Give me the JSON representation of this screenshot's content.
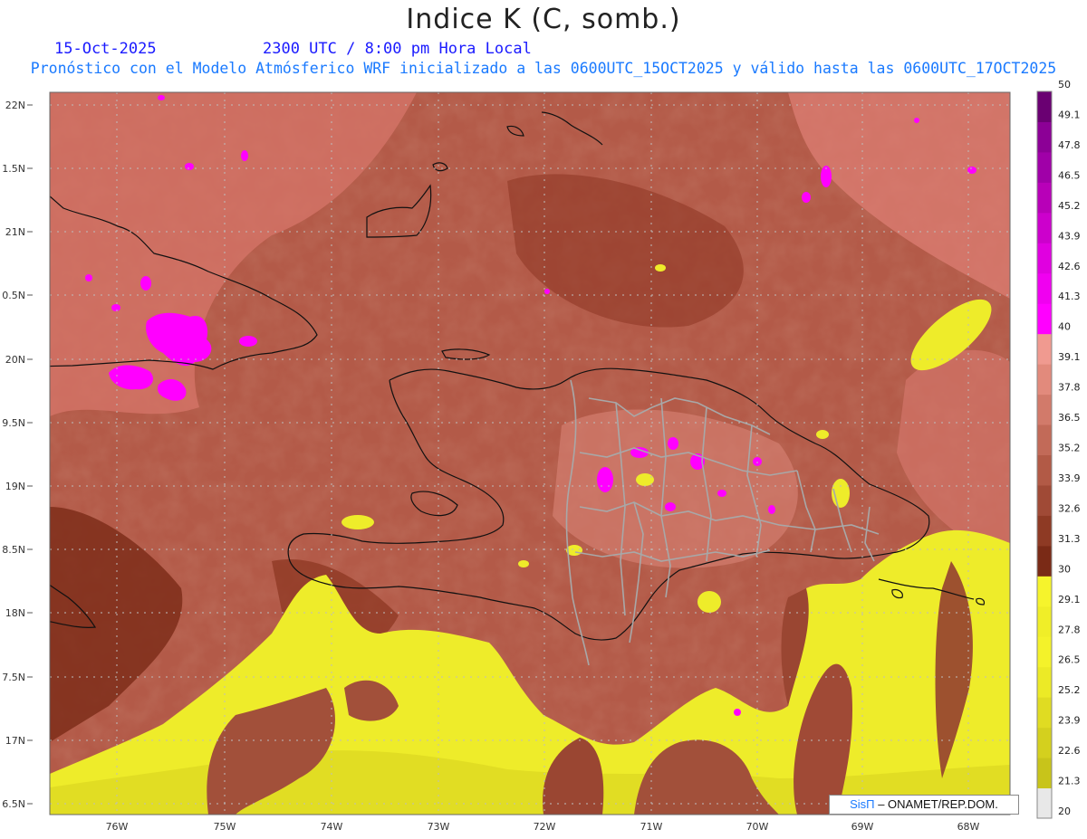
{
  "header": {
    "title": "Indice K (C, somb.)",
    "date": "15-Oct-2025",
    "time": "2300 UTC / 8:00 pm Hora Local",
    "forecast_info": "Pronóstico con el Modelo Atmósferico WRF inicializado a las 0600UTC_15OCT2025 y válido hasta las  0600UTC_17OCT2025"
  },
  "map": {
    "lat_labels": [
      "22N",
      "1.5N",
      "21N",
      "0.5N",
      "20N",
      "9.5N",
      "19N",
      "8.5N",
      "18N",
      "7.5N",
      "17N",
      "6.5N"
    ],
    "lon_labels": [
      "76W",
      "75W",
      "74W",
      "73W",
      "72W",
      "71W",
      "70W",
      "69W",
      "68W"
    ]
  },
  "colorbar": {
    "levels": [
      "20",
      "21.3",
      "22.6",
      "23.9",
      "25.2",
      "26.5",
      "27.8",
      "29.1",
      "30",
      "31.3",
      "32.6",
      "33.9",
      "35.2",
      "36.5",
      "37.8",
      "39.1",
      "40",
      "41.3",
      "42.6",
      "43.9",
      "45.2",
      "46.5",
      "47.8",
      "49.1",
      "50"
    ],
    "colors": [
      "#e8e8e8",
      "#c8c41a",
      "#d4d01e",
      "#e0dc22",
      "#ecea26",
      "#f4f22a",
      "#f0ee28",
      "#f6f42c",
      "#7a2a16",
      "#8e3a24",
      "#a04a36",
      "#b25a46",
      "#c26a58",
      "#d27a6a",
      "#e28a7c",
      "#f09a90",
      "#ff00ff",
      "#f000f0",
      "#e000e0",
      "#cc00cc",
      "#b800b8",
      "#a000a8",
      "#8c0096",
      "#6a0072"
    ]
  },
  "credit": {
    "logo_text": "SisΠ",
    "text": "– ONAMET/REP.DOM."
  }
}
